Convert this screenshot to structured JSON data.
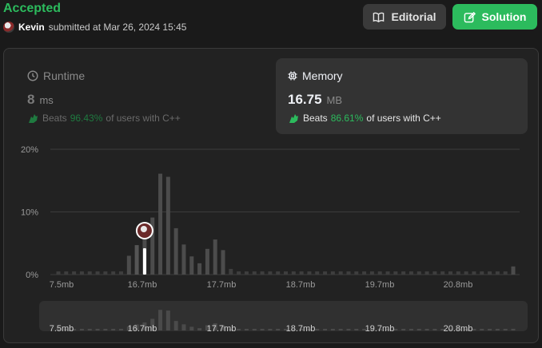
{
  "header": {
    "status": "Accepted",
    "user": "Kevin",
    "submitted_text": "submitted at Mar 26, 2024 15:45"
  },
  "buttons": {
    "editorial": "Editorial",
    "solution": "Solution"
  },
  "runtime": {
    "title": "Runtime",
    "value": "8",
    "unit": "ms",
    "beats_label": "Beats",
    "beats_pct": "96.43%",
    "beats_suffix": "of users with C++"
  },
  "memory": {
    "title": "Memory",
    "value": "16.75",
    "unit": "MB",
    "beats_label": "Beats",
    "beats_pct": "86.61%",
    "beats_suffix": "of users with C++"
  },
  "colors": {
    "accent": "#2cbb5d",
    "bar": "#4a4a4a",
    "highlight": "#ffffff"
  },
  "chart_data": {
    "type": "bar",
    "y_ticks": [
      "20%",
      "10%",
      "0%"
    ],
    "ylim": [
      0,
      20
    ],
    "x_ticks": [
      "7.5mb",
      "16.7mb",
      "17.7mb",
      "18.7mb",
      "19.7mb",
      "20.8mb"
    ],
    "values": [
      0.5,
      0.5,
      0.5,
      0.5,
      0.5,
      0.5,
      0.5,
      0.5,
      0.5,
      3,
      4.7,
      6.3,
      9.1,
      16.1,
      15.6,
      7.4,
      4.8,
      2.9,
      1.8,
      4.1,
      5.6,
      3.9,
      0.9,
      0.5,
      0.5,
      0.5,
      0.5,
      0.5,
      0.5,
      0.5,
      0.5,
      0.5,
      0.5,
      0.5,
      0.5,
      0.5,
      0.5,
      0.5,
      0.5,
      0.5,
      0.5,
      0.5,
      0.5,
      0.5,
      0.5,
      0.5,
      0.5,
      0.5,
      0.5,
      0.5,
      0.5,
      0.5,
      0.5,
      0.5,
      0.5,
      0.5,
      0.5,
      0.5,
      1.3
    ],
    "highlight_index": 10,
    "grid": true,
    "legend": "none"
  }
}
